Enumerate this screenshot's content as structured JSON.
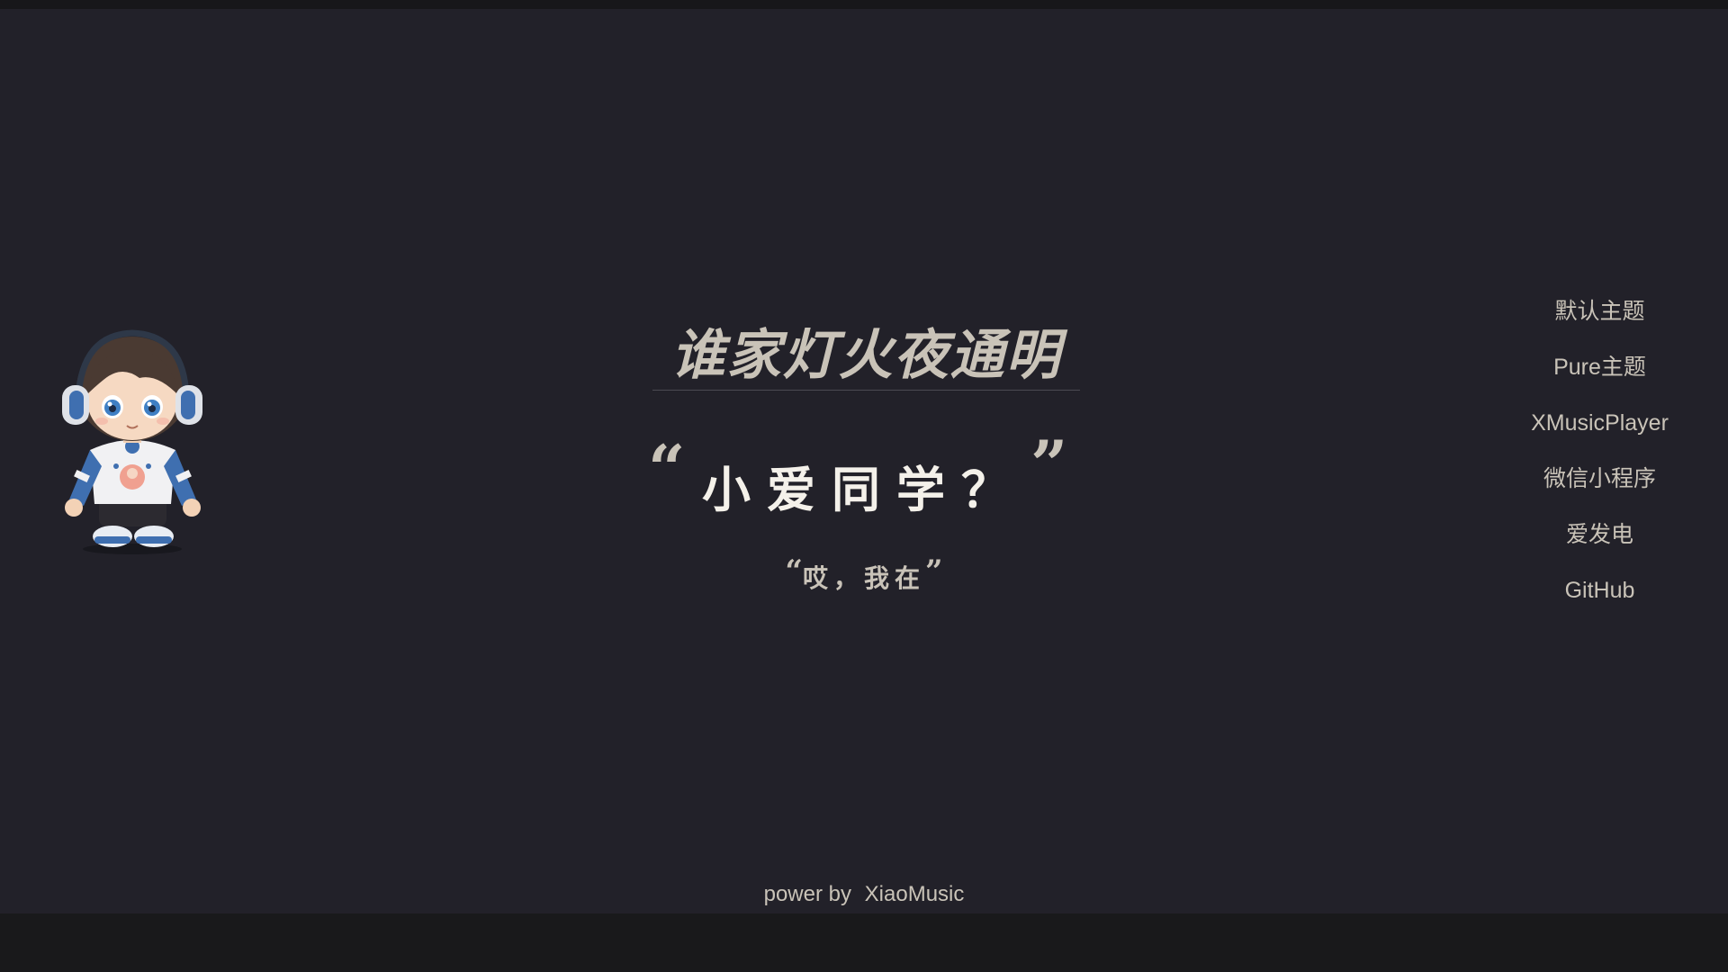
{
  "main": {
    "title": "谁家灯火夜通明",
    "question_quote_open": "“",
    "question": "小爱同学？",
    "question_quote_close": "”",
    "answer_quote_open": "“",
    "answer": "哎，我在",
    "answer_quote_close": "”"
  },
  "menu": {
    "items": [
      {
        "label": "默认主题"
      },
      {
        "label": "Pure主题"
      },
      {
        "label": "XMusicPlayer"
      },
      {
        "label": "微信小程序"
      },
      {
        "label": "爱发电"
      },
      {
        "label": "GitHub"
      }
    ]
  },
  "footer": {
    "prefix": "power by",
    "link": "XiaoMusic"
  },
  "mascot": {
    "icon": "chibi-girl-with-headphones-illustration"
  },
  "colors": {
    "background": "#222129",
    "text": "#c9c3b8",
    "heading": "#f4f1ea",
    "bottom_bar": "#19191b",
    "accent_blue": "#3f6fb0"
  }
}
